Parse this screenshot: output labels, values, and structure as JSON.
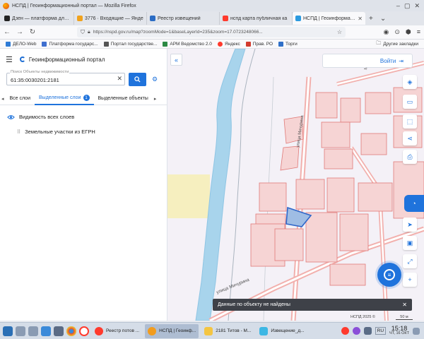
{
  "window": {
    "title": "НСПД | Геоинформационный портал — Mozilla Firefox"
  },
  "tabs": [
    {
      "label": "Дзен — платформа для п",
      "color": "#222222",
      "active": false
    },
    {
      "label": "3776 · Входящие — Янде",
      "color": "#f0a21d",
      "active": false
    },
    {
      "label": "Реестр извещений",
      "color": "#2b6cc4",
      "active": false
    },
    {
      "label": "нспд карта публичная ка",
      "color": "#ff3a2d",
      "active": false
    },
    {
      "label": "НСПД | Геоинформационн",
      "color": "#2b9adf",
      "active": true
    }
  ],
  "navbar": {
    "url": "https://nspd.gov.ru/map?zoomMode=1&baseLayerId=235&zoom=17.0723248066..."
  },
  "bookmarks": [
    {
      "label": "ДЕЛО-Web",
      "color": "#2e7bd6"
    },
    {
      "label": "Платформа государс...",
      "color": "#3f6fcf"
    },
    {
      "label": "Портал государстве...",
      "color": "#555555"
    },
    {
      "label": "АРМ Ведомство 2.0",
      "color": "#2c8a44"
    },
    {
      "label": "Яндекс",
      "color": "#ff3a2d"
    },
    {
      "label": "Прав. РО",
      "color": "#d23a2d"
    },
    {
      "label": "Торги",
      "color": "#3070c8"
    }
  ],
  "bookmarks_other": "Другие закладки",
  "panel": {
    "title": "Геоинформационный портал",
    "search_label": "Поиск Объекты недвижимости",
    "search_value": "61:35:0030201:2181",
    "subtabs": [
      "Все слои",
      "Выделенные слои",
      "Выделенные объекты"
    ],
    "badge_count": "1",
    "layers_visibility": "Видимость всех слоев",
    "layer_item": "Земельные участки из ЕГРН"
  },
  "map": {
    "login": "Войти",
    "street_1": "улица Мичурина",
    "street_2": "Мира",
    "toast": "Данные по объекту не найдены",
    "copyright": "НСПД 2025 ©",
    "scale": "50 м"
  },
  "taskbar": {
    "items": [
      {
        "label": "Реестр потов ...",
        "color": "#ff3a2d",
        "active": false
      },
      {
        "label": "НСПД | Геоинф...",
        "color": "#f29c1e",
        "active": true
      },
      {
        "label": "2181 Титов - М...",
        "color": "#f4c542",
        "active": false
      },
      {
        "label": "Извещение_д...",
        "color": "#3db7e4",
        "active": false
      }
    ],
    "lang": "RU",
    "time": "15:18",
    "date": "ЧТ, 16 ОКТ"
  }
}
